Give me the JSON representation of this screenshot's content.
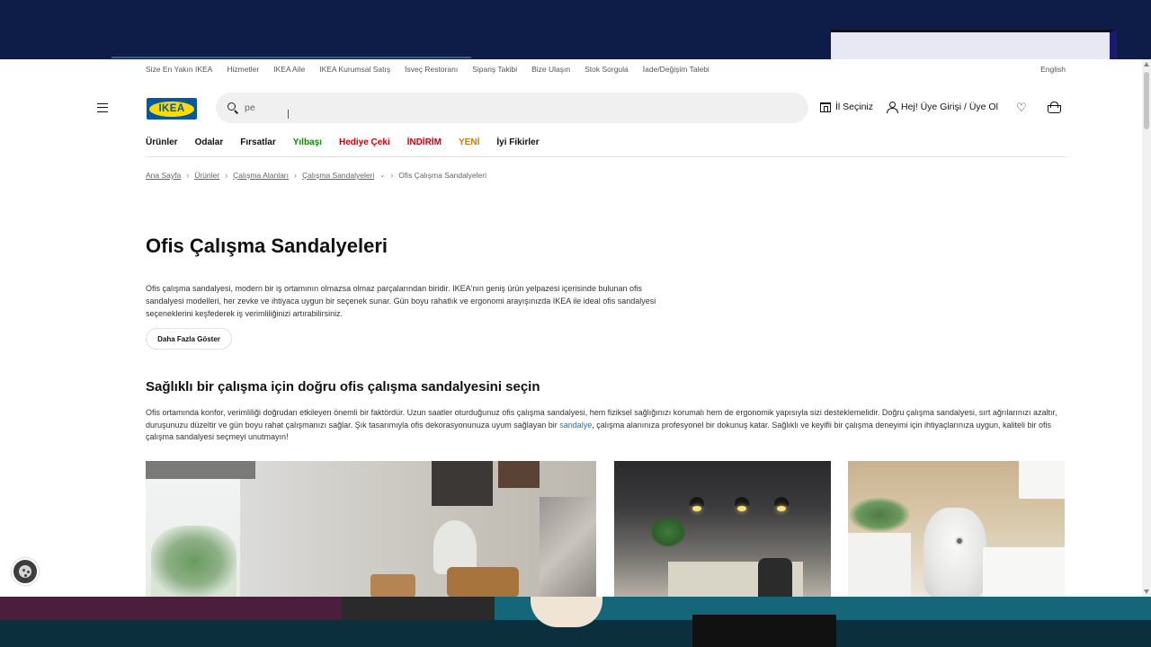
{
  "utility_nav": {
    "links": [
      "Size En Yakın IKEA",
      "Hizmetler",
      "IKEA Aile",
      "IKEA Kurumsal Satış",
      "İsveç Restoranı",
      "Sipariş Takibi",
      "Bize Ulaşın",
      "Stok Sorgula",
      "İade/Değişim Talebi"
    ],
    "language": "English"
  },
  "header": {
    "logo_text": "IKEA",
    "search_value": "pe",
    "store_label": "İl Seçiniz",
    "account_label": "Hej! Üye Girişi / Üye Ol"
  },
  "main_nav": [
    {
      "label": "Ürünler",
      "color": "#111111"
    },
    {
      "label": "Odalar",
      "color": "#111111"
    },
    {
      "label": "Fırsatlar",
      "color": "#111111"
    },
    {
      "label": "Yılbaşı",
      "color": "#0a8a00"
    },
    {
      "label": "Hediye Çeki",
      "color": "#cc0008"
    },
    {
      "label": "İNDİRİM",
      "color": "#cc0008"
    },
    {
      "label": "YENİ",
      "color": "#d27a00"
    },
    {
      "label": "İyi Fikirler",
      "color": "#111111"
    }
  ],
  "breadcrumb": [
    "Ana Sayfa",
    "Ürünler",
    "Çalışma Alanları",
    "Çalışma Sandalyeleri",
    "Ofis Çalışma Sandalyeleri"
  ],
  "page": {
    "title": "Ofis Çalışma Sandalyeleri",
    "intro": "Ofis çalışma sandalyesi, modern bir iş ortamının olmazsa olmaz parçalarından biridir. IKEA'nın geniş ürün yelpazesi içerisinde bulunan ofis sandalyesi modelleri, her zevke ve ihtiyaca uygun bir seçenek sunar. Gün boyu rahatlık ve ergonomi arayışınızda IKEA ile ideal ofis sandalyesi seçeneklerini keşfederek iş verimliliğinizi artırabilirsiniz.",
    "more_button": "Daha Fazla Göster",
    "section_title": "Sağlıklı bir çalışma için doğru ofis çalışma sandalyesini seçin",
    "section_text_before": "Ofis ortamında konfor, verimliliği doğrudan etkileyen önemli bir faktördür. Uzun saatler oturduğunuz ofis çalışma sandalyesi, hem fiziksel sağlığınızı korumalı hem de ergonomik yapısıyla sizi desteklemelidir. Doğru çalışma sandalyesi, sırt ağrılarınızı azaltır, duruşunuzu düzeltir ve gün boyu rahat çalışmanızı sağlar. Şık tasarımıyla ofis dekorasyonunuza uyum sağlayan bir ",
    "section_link": "sandalye",
    "section_text_after": ", çalışma alanınıza profesyonel bir dokunuş katar. Sağlıklı ve keyifli bir çalışma deneyimi için ihtiyaçlarınıza uygun, kaliteli bir ofis çalışma sandalyesi seçmeyi unutmayın!"
  }
}
